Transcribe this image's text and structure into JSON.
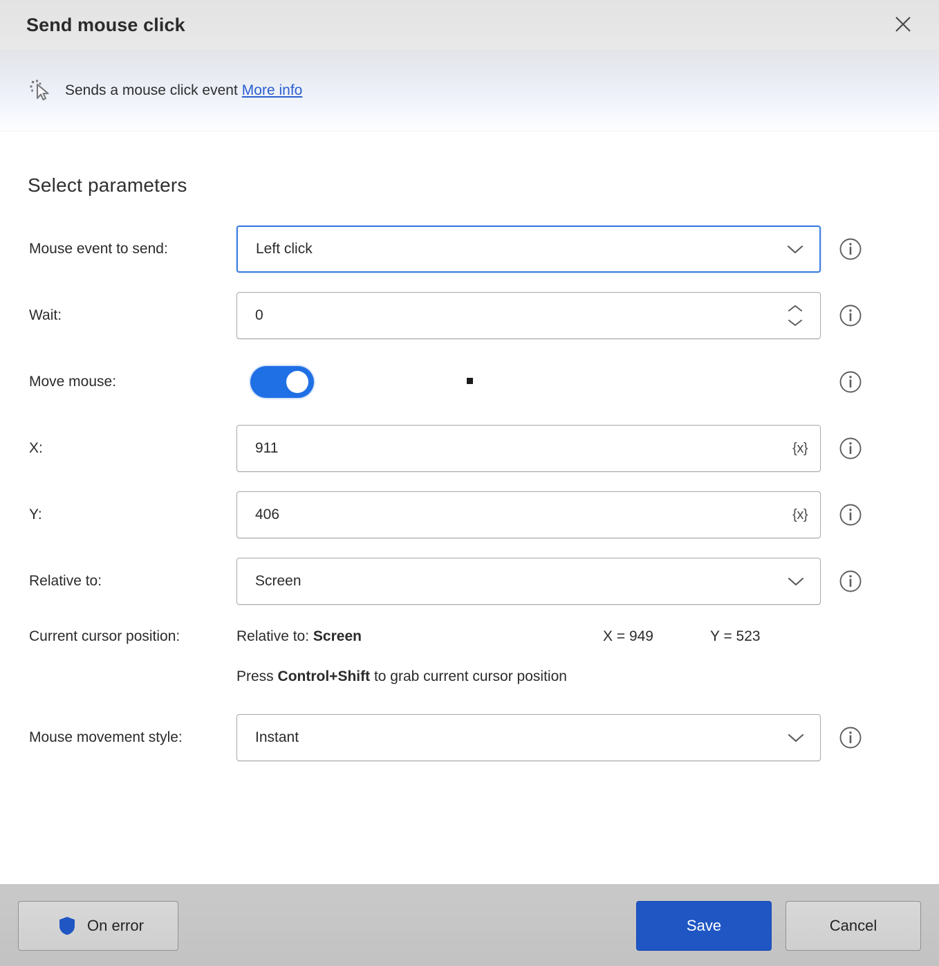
{
  "dialog": {
    "title": "Send mouse click",
    "close_icon": "close-icon"
  },
  "info_banner": {
    "icon": "mouse-click-cursor-icon",
    "description": "Sends a mouse click event",
    "link_label": "More info"
  },
  "body": {
    "section_title": "Select parameters"
  },
  "fields": {
    "mouse_event": {
      "label": "Mouse event to send:",
      "value": "Left click",
      "type": "dropdown",
      "focused": true,
      "info_icon": "info-icon"
    },
    "wait": {
      "label": "Wait:",
      "value": "0",
      "type": "spinner",
      "info_icon": "info-icon"
    },
    "move_mouse": {
      "label": "Move mouse:",
      "value": "on",
      "type": "toggle",
      "info_icon": "info-icon"
    },
    "x": {
      "label": "X:",
      "value": "911",
      "type": "text",
      "variable_label": "{x}",
      "info_icon": "info-icon"
    },
    "y": {
      "label": "Y:",
      "value": "406",
      "type": "text",
      "variable_label": "{x}",
      "info_icon": "info-icon"
    },
    "relative_to": {
      "label": "Relative to:",
      "value": "Screen",
      "type": "dropdown",
      "info_icon": "info-icon"
    },
    "movement_style": {
      "label": "Mouse movement style:",
      "value": "Instant",
      "type": "dropdown",
      "info_icon": "info-icon"
    }
  },
  "cursor_position": {
    "label": "Current cursor position:",
    "relative_prefix": "Relative to:",
    "relative_value": "Screen",
    "x_readout": "X = 949",
    "y_readout": "Y = 523",
    "hint_prefix": "Press",
    "hint_keys": "Control+Shift",
    "hint_suffix": "to grab current cursor position"
  },
  "footer": {
    "on_error_label": "On error",
    "on_error_icon": "shield-icon",
    "save_label": "Save",
    "cancel_label": "Cancel"
  },
  "colors": {
    "accent_blue": "#1f56c4",
    "toggle_blue": "#1f6fe5",
    "link_blue": "#2a5fd0",
    "focus_border": "#3f7fe0",
    "shield_blue": "#1f56c4"
  }
}
